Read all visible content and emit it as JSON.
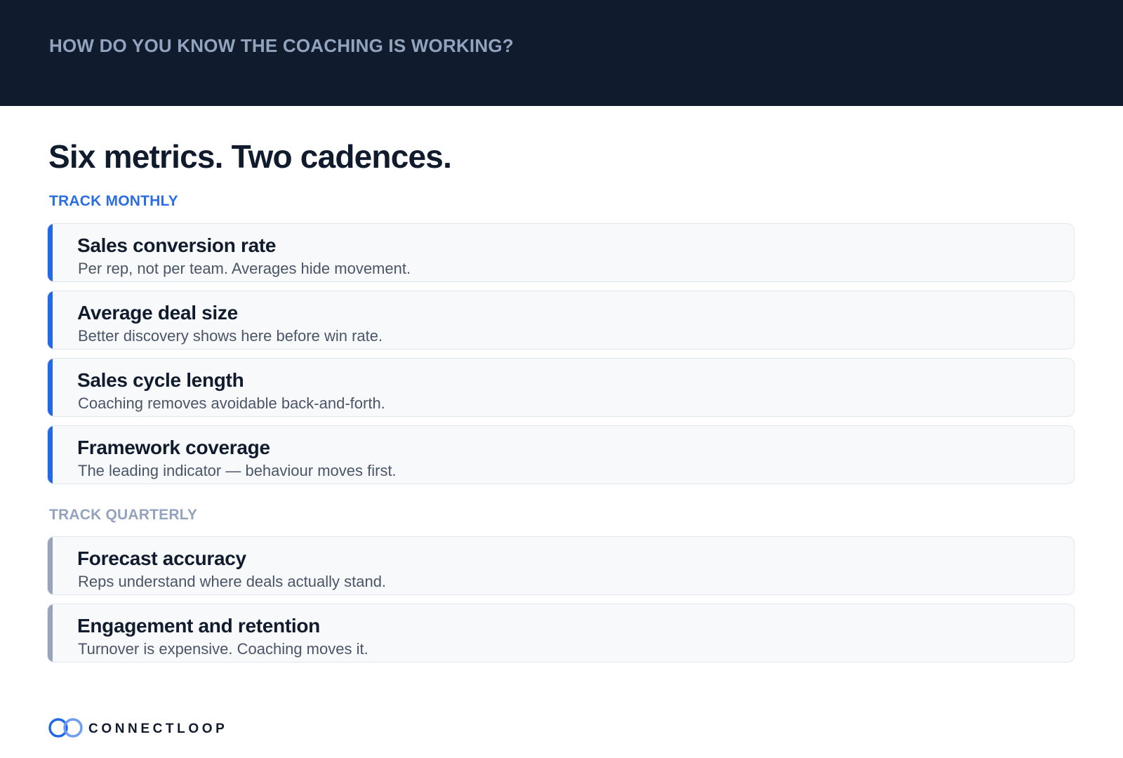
{
  "header": {
    "eyebrow": "HOW DO YOU KNOW THE COACHING IS WORKING?"
  },
  "title": "Six metrics. Two cadences.",
  "sections": [
    {
      "label": "TRACK MONTHLY",
      "accent_color": "#2169e6",
      "label_color": "#2b6de3",
      "items": [
        {
          "title": "Sales conversion rate",
          "desc": "Per rep, not per team. Averages hide movement."
        },
        {
          "title": "Average deal size",
          "desc": "Better discovery shows here before win rate."
        },
        {
          "title": "Sales cycle length",
          "desc": "Coaching removes avoidable back-and-forth."
        },
        {
          "title": "Framework coverage",
          "desc": "The leading indicator — behaviour moves first."
        }
      ]
    },
    {
      "label": "TRACK QUARTERLY",
      "accent_color": "#97a4b9",
      "label_color": "#93a3bd",
      "items": [
        {
          "title": "Forecast accuracy",
          "desc": "Reps understand where deals actually stand."
        },
        {
          "title": "Engagement and retention",
          "desc": "Turnover is expensive. Coaching moves it."
        }
      ]
    }
  ],
  "footer": {
    "brand": "CONNECTLOOP",
    "logo_icon": "interlocking-rings-icon"
  },
  "colors": {
    "header_bg": "#111b2e",
    "primary_text": "#111b2e",
    "brand_blue": "#2169e6"
  }
}
